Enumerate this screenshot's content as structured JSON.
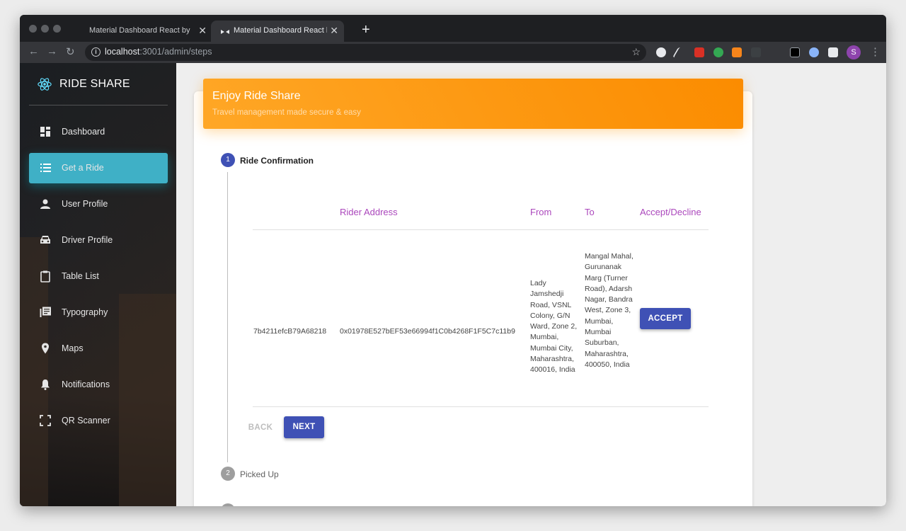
{
  "browser": {
    "tabs": [
      {
        "label": "Material Dashboard React by C"
      },
      {
        "label": "Material Dashboard React by C"
      }
    ],
    "url_host": "localhost",
    "url_path": ":3001/admin/steps",
    "profile_initial": "S"
  },
  "sidebar": {
    "brand": "RIDE SHARE",
    "items": [
      {
        "label": "Dashboard",
        "icon": "dashboard-icon"
      },
      {
        "label": "Get a Ride",
        "icon": "list-icon",
        "active": true
      },
      {
        "label": "User Profile",
        "icon": "person-icon"
      },
      {
        "label": "Driver Profile",
        "icon": "car-icon"
      },
      {
        "label": "Table List",
        "icon": "clipboard-icon"
      },
      {
        "label": "Typography",
        "icon": "library-books-icon"
      },
      {
        "label": "Maps",
        "icon": "location-pin-icon"
      },
      {
        "label": "Notifications",
        "icon": "bell-icon"
      },
      {
        "label": "QR Scanner",
        "icon": "fullscreen-icon"
      }
    ]
  },
  "card": {
    "title": "Enjoy Ride Share",
    "subtitle": "Travel management made secure & easy"
  },
  "steps": [
    {
      "number": "1",
      "label": "Ride Confirmation",
      "active": true
    },
    {
      "number": "2",
      "label": "Picked Up",
      "active": false
    }
  ],
  "table": {
    "headers": [
      "",
      "Rider Address",
      "From",
      "To",
      "Accept/Decline"
    ],
    "rows": [
      {
        "id": "7b4211efcB79A68218",
        "rider_address": "0x01978E527bEF53e66994f1C0b4268F1F5C7c11b9",
        "from": "Lady Jamshedji Road, VSNL Colony, G/N Ward, Zone 2, Mumbai, Mumbai City, Maharashtra, 400016, India",
        "to": "Mangal Mahal, Gurunanak Marg (Turner Road), Adarsh Nagar, Bandra West, Zone 3, Mumbai, Mumbai Suburban, Maharashtra, 400050, India",
        "action": "ACCEPT"
      }
    ]
  },
  "buttons": {
    "back": "BACK",
    "next": "NEXT"
  },
  "colors": {
    "accent": "#3f51b5",
    "header_orange": "#fb8c00",
    "sidebar_active": "#3fb0c6",
    "table_header": "#ab47bc"
  }
}
